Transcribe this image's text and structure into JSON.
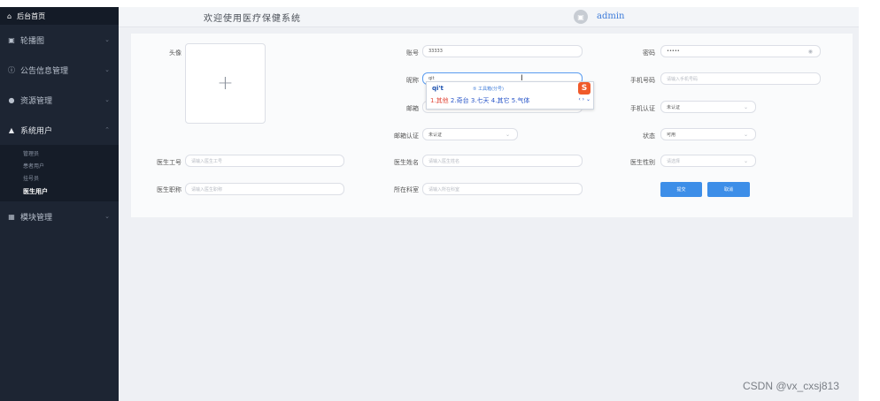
{
  "sidebar": {
    "home": "后台首页",
    "menus": [
      {
        "label": "轮播图"
      },
      {
        "label": "公告信息管理"
      },
      {
        "label": "资源管理"
      },
      {
        "label": "系统用户"
      }
    ],
    "submenu": [
      "管理员",
      "患者用户",
      "挂号员",
      "医生用户"
    ],
    "module": "模块管理"
  },
  "topbar": {
    "welcome": "欢迎使用医疗保健系统",
    "user": "admin"
  },
  "form": {
    "avatar_label": "头像",
    "account_label": "账号",
    "account_value": "33333",
    "password_label": "密码",
    "password_value": "•••••",
    "nickname_label": "昵称",
    "nickname_value": "qit",
    "phone_label": "手机号码",
    "phone_placeholder": "请输入手机号码",
    "email_label": "邮箱",
    "phone_verify_label": "手机认证",
    "phone_verify_value": "未认证",
    "email_verify_label": "邮箱认证",
    "email_verify_value": "未认证",
    "status_label": "状态",
    "status_value": "可用",
    "doctor_id_label": "医生工号",
    "doctor_id_placeholder": "请输入医生工号",
    "doctor_name_label": "医生姓名",
    "doctor_name_placeholder": "请输入医生姓名",
    "doctor_gender_label": "医生性别",
    "doctor_gender_placeholder": "请选择",
    "doctor_title_label": "医生职称",
    "doctor_title_placeholder": "请输入医生职称",
    "department_label": "所在科室",
    "department_placeholder": "请输入所在科室",
    "submit_label": "提交",
    "cancel_label": "取消"
  },
  "ime": {
    "composition": "qi't",
    "hint": "⑤ 工具箱(分号)",
    "candidates": [
      "1.其他",
      "2.奇台",
      "3.七天",
      "4.其它",
      "5.气体"
    ],
    "logo": "S"
  },
  "watermark": "CSDN @vx_cxsj813"
}
